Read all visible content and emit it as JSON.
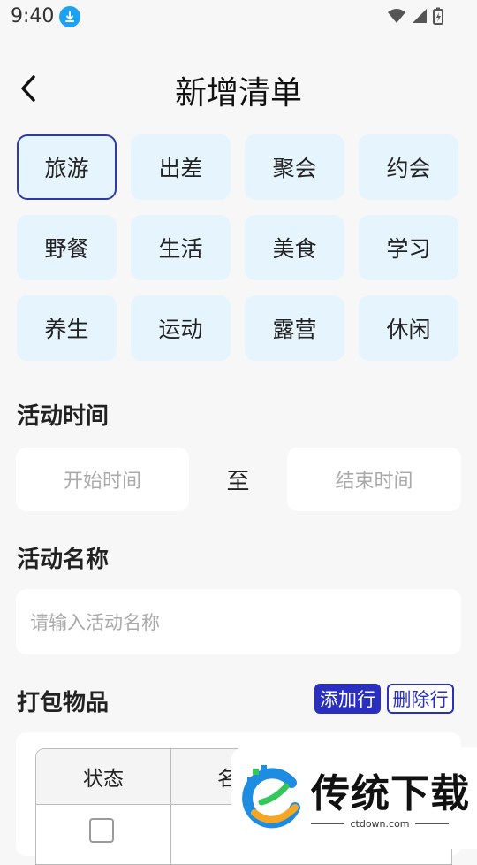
{
  "status_bar": {
    "time": "9:40"
  },
  "header": {
    "title": "新增清单"
  },
  "categories": [
    {
      "label": "旅游",
      "selected": true
    },
    {
      "label": "出差",
      "selected": false
    },
    {
      "label": "聚会",
      "selected": false
    },
    {
      "label": "约会",
      "selected": false
    },
    {
      "label": "野餐",
      "selected": false
    },
    {
      "label": "生活",
      "selected": false
    },
    {
      "label": "美食",
      "selected": false
    },
    {
      "label": "学习",
      "selected": false
    },
    {
      "label": "养生",
      "selected": false
    },
    {
      "label": "运动",
      "selected": false
    },
    {
      "label": "露营",
      "selected": false
    },
    {
      "label": "休闲",
      "selected": false
    }
  ],
  "activity_time": {
    "label": "活动时间",
    "start_placeholder": "开始时间",
    "separator": "至",
    "end_placeholder": "结束时间"
  },
  "activity_name": {
    "label": "活动名称",
    "placeholder": "请输入活动名称"
  },
  "packing": {
    "label": "打包物品",
    "add_button": "添加行",
    "delete_button": "删除行",
    "columns": [
      "状态",
      "名"
    ]
  },
  "watermark": {
    "brand": "传统下载",
    "site": "ctdown.com"
  },
  "colors": {
    "accent": "#2a2fc0",
    "chip_bg": "#e6f4fd",
    "page_bg": "#f7f7f7"
  }
}
